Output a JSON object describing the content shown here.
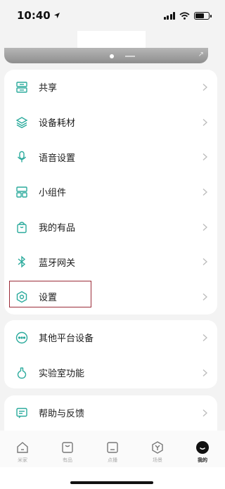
{
  "status": {
    "time": "10:40"
  },
  "menu_group_1": [
    {
      "label": "共享",
      "icon": "share-icon"
    },
    {
      "label": "设备耗材",
      "icon": "layers-icon"
    },
    {
      "label": "语音设置",
      "icon": "microphone-icon"
    },
    {
      "label": "小组件",
      "icon": "widget-icon"
    },
    {
      "label": "我的有品",
      "icon": "shopping-bag-icon"
    },
    {
      "label": "蓝牙网关",
      "icon": "bluetooth-icon"
    },
    {
      "label": "设置",
      "icon": "settings-hexagon-icon"
    }
  ],
  "menu_group_2": [
    {
      "label": "其他平台设备",
      "icon": "more-dots-icon"
    },
    {
      "label": "实验室功能",
      "icon": "flask-icon"
    }
  ],
  "menu_group_3": [
    {
      "label": "帮助与反馈",
      "icon": "feedback-icon"
    }
  ],
  "tabs": [
    {
      "label": "米家",
      "icon": "home-icon"
    },
    {
      "label": "有品",
      "icon": "store-icon"
    },
    {
      "label": "点播",
      "icon": "play-icon"
    },
    {
      "label": "场景",
      "icon": "scene-icon"
    },
    {
      "label": "我的",
      "icon": "profile-icon",
      "active": true
    }
  ],
  "colors": {
    "accent": "#2aaa9c",
    "highlight_border": "#9b2c38",
    "background": "#f3f3f3"
  }
}
